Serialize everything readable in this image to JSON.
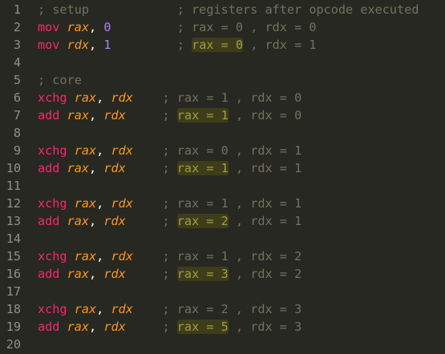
{
  "editor": {
    "lines": [
      {
        "num": "1",
        "parts": [
          {
            "t": "cm",
            "v": "; setup"
          },
          {
            "t": "pad",
            "v": "            "
          },
          {
            "t": "cm",
            "v": "; registers after opcode executed"
          }
        ]
      },
      {
        "num": "2",
        "parts": [
          {
            "t": "kw",
            "v": "mov"
          },
          {
            "t": "txt",
            "v": " "
          },
          {
            "t": "reg",
            "v": "rax"
          },
          {
            "t": "txt",
            "v": ", "
          },
          {
            "t": "num",
            "v": "0"
          },
          {
            "t": "pad",
            "v": "         "
          },
          {
            "t": "cm",
            "v": "; rax = 0 , rdx = 0"
          }
        ]
      },
      {
        "num": "3",
        "parts": [
          {
            "t": "kw",
            "v": "mov"
          },
          {
            "t": "txt",
            "v": " "
          },
          {
            "t": "reg",
            "v": "rdx"
          },
          {
            "t": "txt",
            "v": ", "
          },
          {
            "t": "num",
            "v": "1"
          },
          {
            "t": "pad",
            "v": "         "
          },
          {
            "t": "cm",
            "v": "; "
          },
          {
            "t": "hl",
            "v": "rax = 0"
          },
          {
            "t": "cm",
            "v": " , rdx = 1"
          }
        ]
      },
      {
        "num": "4",
        "parts": []
      },
      {
        "num": "5",
        "parts": [
          {
            "t": "cm",
            "v": "; core"
          }
        ]
      },
      {
        "num": "6",
        "parts": [
          {
            "t": "kw",
            "v": "xchg"
          },
          {
            "t": "txt",
            "v": " "
          },
          {
            "t": "reg",
            "v": "rax"
          },
          {
            "t": "txt",
            "v": ", "
          },
          {
            "t": "reg",
            "v": "rdx"
          },
          {
            "t": "pad",
            "v": "    "
          },
          {
            "t": "cm",
            "v": "; rax = 1 , rdx = 0"
          }
        ]
      },
      {
        "num": "7",
        "parts": [
          {
            "t": "kw",
            "v": "add"
          },
          {
            "t": "txt",
            "v": " "
          },
          {
            "t": "reg",
            "v": "rax"
          },
          {
            "t": "txt",
            "v": ", "
          },
          {
            "t": "reg",
            "v": "rdx"
          },
          {
            "t": "pad",
            "v": "     "
          },
          {
            "t": "cm",
            "v": "; "
          },
          {
            "t": "hl",
            "v": "rax = 1"
          },
          {
            "t": "cm",
            "v": " , rdx = 0"
          }
        ]
      },
      {
        "num": "8",
        "parts": []
      },
      {
        "num": "9",
        "parts": [
          {
            "t": "kw",
            "v": "xchg"
          },
          {
            "t": "txt",
            "v": " "
          },
          {
            "t": "reg",
            "v": "rax"
          },
          {
            "t": "txt",
            "v": ", "
          },
          {
            "t": "reg",
            "v": "rdx"
          },
          {
            "t": "pad",
            "v": "    "
          },
          {
            "t": "cm",
            "v": "; rax = 0 , rdx = 1"
          }
        ]
      },
      {
        "num": "10",
        "parts": [
          {
            "t": "kw",
            "v": "add"
          },
          {
            "t": "txt",
            "v": " "
          },
          {
            "t": "reg",
            "v": "rax"
          },
          {
            "t": "txt",
            "v": ", "
          },
          {
            "t": "reg",
            "v": "rdx"
          },
          {
            "t": "pad",
            "v": "     "
          },
          {
            "t": "cm",
            "v": "; "
          },
          {
            "t": "hl",
            "v": "rax = 1"
          },
          {
            "t": "cm",
            "v": " , rdx = 1"
          }
        ]
      },
      {
        "num": "11",
        "parts": []
      },
      {
        "num": "12",
        "parts": [
          {
            "t": "kw",
            "v": "xchg"
          },
          {
            "t": "txt",
            "v": " "
          },
          {
            "t": "reg",
            "v": "rax"
          },
          {
            "t": "txt",
            "v": ", "
          },
          {
            "t": "reg",
            "v": "rdx"
          },
          {
            "t": "pad",
            "v": "    "
          },
          {
            "t": "cm",
            "v": "; rax = 1 , rdx = 1"
          }
        ]
      },
      {
        "num": "13",
        "parts": [
          {
            "t": "kw",
            "v": "add"
          },
          {
            "t": "txt",
            "v": " "
          },
          {
            "t": "reg",
            "v": "rax"
          },
          {
            "t": "txt",
            "v": ", "
          },
          {
            "t": "reg",
            "v": "rdx"
          },
          {
            "t": "pad",
            "v": "     "
          },
          {
            "t": "cm",
            "v": "; "
          },
          {
            "t": "hl",
            "v": "rax = 2"
          },
          {
            "t": "cm",
            "v": " , rdx = 1"
          }
        ]
      },
      {
        "num": "14",
        "parts": []
      },
      {
        "num": "15",
        "parts": [
          {
            "t": "kw",
            "v": "xchg"
          },
          {
            "t": "txt",
            "v": " "
          },
          {
            "t": "reg",
            "v": "rax"
          },
          {
            "t": "txt",
            "v": ", "
          },
          {
            "t": "reg",
            "v": "rdx"
          },
          {
            "t": "pad",
            "v": "    "
          },
          {
            "t": "cm",
            "v": "; rax = 1 , rdx = 2"
          }
        ]
      },
      {
        "num": "16",
        "parts": [
          {
            "t": "kw",
            "v": "add"
          },
          {
            "t": "txt",
            "v": " "
          },
          {
            "t": "reg",
            "v": "rax"
          },
          {
            "t": "txt",
            "v": ", "
          },
          {
            "t": "reg",
            "v": "rdx"
          },
          {
            "t": "pad",
            "v": "     "
          },
          {
            "t": "cm",
            "v": "; "
          },
          {
            "t": "hl",
            "v": "rax = 3"
          },
          {
            "t": "cm",
            "v": " , rdx = 2"
          }
        ]
      },
      {
        "num": "17",
        "parts": []
      },
      {
        "num": "18",
        "parts": [
          {
            "t": "kw",
            "v": "xchg"
          },
          {
            "t": "txt",
            "v": " "
          },
          {
            "t": "reg",
            "v": "rax"
          },
          {
            "t": "txt",
            "v": ", "
          },
          {
            "t": "reg",
            "v": "rdx"
          },
          {
            "t": "pad",
            "v": "    "
          },
          {
            "t": "cm",
            "v": "; rax = 2 , rdx = 3"
          }
        ]
      },
      {
        "num": "19",
        "parts": [
          {
            "t": "kw",
            "v": "add"
          },
          {
            "t": "txt",
            "v": " "
          },
          {
            "t": "reg",
            "v": "rax"
          },
          {
            "t": "txt",
            "v": ", "
          },
          {
            "t": "reg",
            "v": "rdx"
          },
          {
            "t": "pad",
            "v": "     "
          },
          {
            "t": "cm",
            "v": "; "
          },
          {
            "t": "hl",
            "v": "rax = 5"
          },
          {
            "t": "cm",
            "v": " , rdx = 3"
          }
        ]
      },
      {
        "num": "20",
        "parts": []
      }
    ]
  }
}
